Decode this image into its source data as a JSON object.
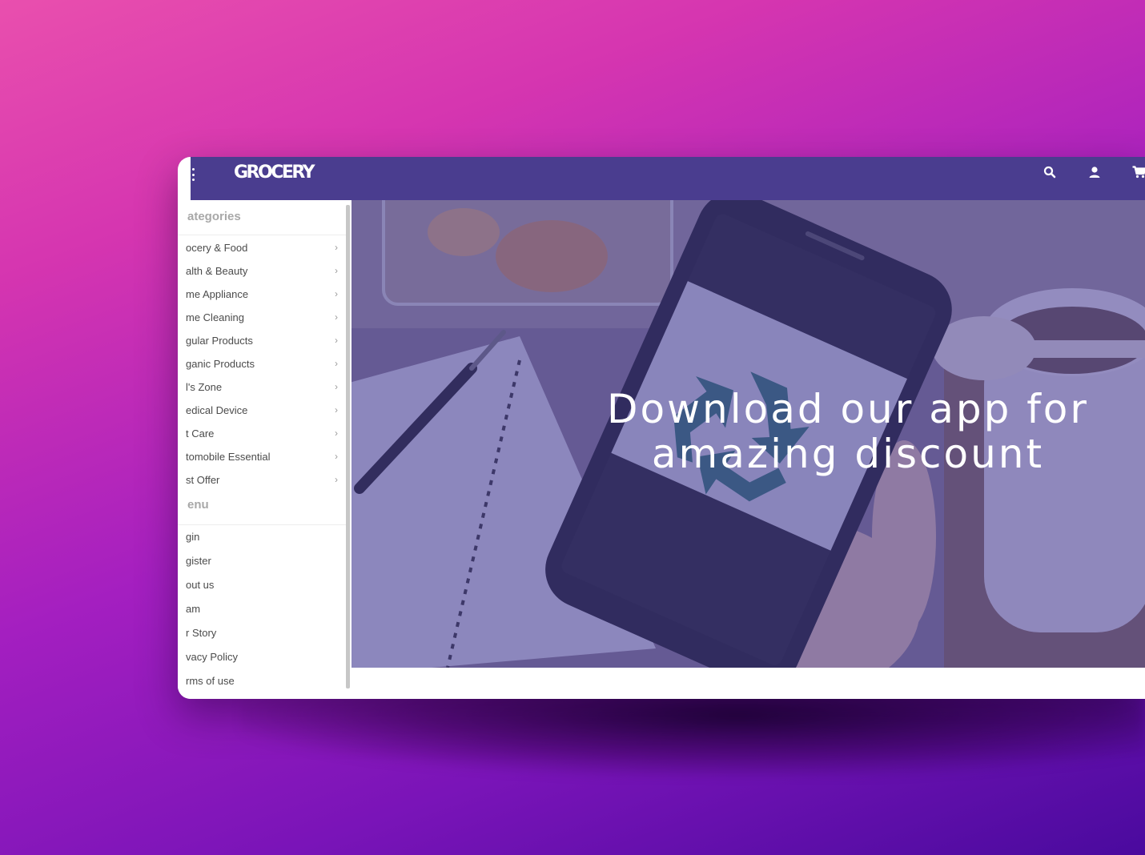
{
  "header": {
    "logo": "GROCERY",
    "icons": [
      "menu-icon",
      "search-icon",
      "user-icon",
      "cart-icon"
    ]
  },
  "sidebar": {
    "categories_heading": "ategories",
    "categories": [
      "ocery & Food",
      "alth & Beauty",
      "me Appliance",
      "me Cleaning",
      "gular Products",
      "ganic Products",
      "l's Zone",
      "edical Device",
      "t Care",
      "tomobile Essential",
      "st Offer"
    ],
    "menu_heading": "enu",
    "menu": [
      "gin",
      "gister",
      "out us",
      "am",
      "r Story",
      "vacy Policy",
      "rms of use"
    ]
  },
  "hero": {
    "title": "Download our app for amazing discount"
  },
  "colors": {
    "topbar": "#4a3d8f",
    "accent_overlay": "#463c96",
    "recycle_green": "#2f6f6b"
  }
}
